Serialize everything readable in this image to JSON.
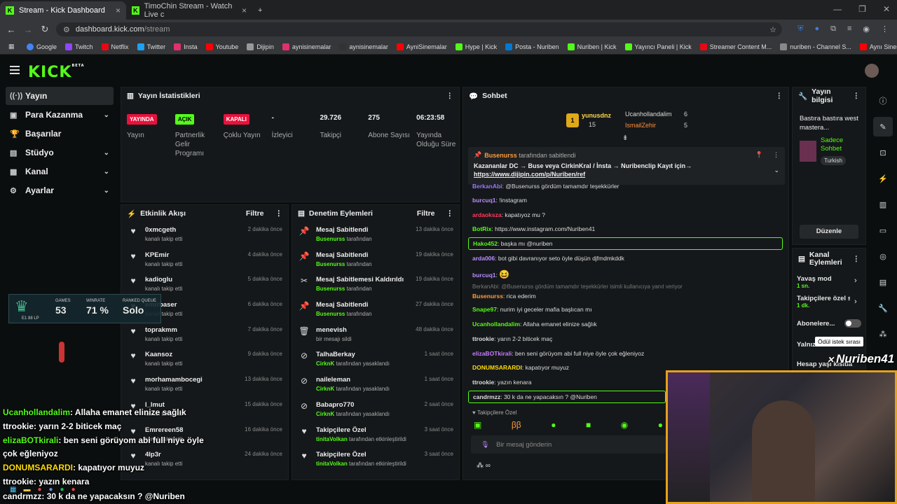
{
  "browser": {
    "tabs": [
      {
        "label": "Stream - Kick Dashboard"
      },
      {
        "label": "TimoChin Stream - Watch Live c"
      }
    ],
    "url_host": "dashboard.kick.com",
    "url_path": "/stream",
    "bookmarks": [
      "Google",
      "Twitch",
      "Netflix",
      "Twitter",
      "Insta",
      "Youtube",
      "Dijipin",
      "aynisinemalar",
      "aynisinemalar",
      "AyniSinemalar",
      "Hype | Kick",
      "Posta - Nuriben",
      "Nuriben | Kick",
      "Yayıncı Paneli | Kick",
      "Streamer Content M...",
      "nuriben - Channel S...",
      "Aynı Sinemalar - Ça..."
    ]
  },
  "header": {
    "logo": "KICK",
    "logo_sup": "BETA"
  },
  "sidebar": {
    "items": [
      {
        "label": "Yayın"
      },
      {
        "label": "Para Kazanma"
      },
      {
        "label": "Başarılar"
      },
      {
        "label": "Stüdyo"
      },
      {
        "label": "Kanal"
      },
      {
        "label": "Ayarlar"
      }
    ]
  },
  "stats": {
    "title": "Yayın İstatistikleri",
    "items": [
      {
        "value": "YAYINDA",
        "label": "Yayın"
      },
      {
        "value": "AÇIK",
        "label": "Partnerlik Gelir Programı"
      },
      {
        "value": "KAPALI",
        "label": "Çoklu Yayın"
      },
      {
        "value": "-",
        "label": "İzleyici"
      },
      {
        "value": "29.726",
        "label": "Takipçi"
      },
      {
        "value": "275",
        "label": "Abone Sayısı"
      },
      {
        "value": "06:23:58",
        "label": "Yayında Olduğu Süre"
      }
    ]
  },
  "activity": {
    "title": "Etkinlik Akışı",
    "filter": "Filtre",
    "events": [
      {
        "name": "0xmcgeth",
        "sub": "kanalı takip etti",
        "time": "2 dakika önce"
      },
      {
        "name": "KPEmir",
        "sub": "kanalı takip etti",
        "time": "4 dakika önce"
      },
      {
        "name": "kadioglu",
        "sub": "kanalı takip etti",
        "time": "5 dakika önce"
      },
      {
        "name": "emirbaser",
        "sub": "kanalı takip etti",
        "time": "6 dakika önce"
      },
      {
        "name": "toprakmm",
        "sub": "kanalı takip etti",
        "time": "7 dakika önce"
      },
      {
        "name": "Kaansoz",
        "sub": "kanalı takip etti",
        "time": "9 dakika önce"
      },
      {
        "name": "morhamambocegi",
        "sub": "kanalı takip etti",
        "time": "13 dakika önce"
      },
      {
        "name": "l_lmut",
        "sub": "kanalı takip etti",
        "time": "15 dakika önce"
      },
      {
        "name": "Emrereen58",
        "sub": "kanalı takip etti",
        "time": "16 dakika önce"
      },
      {
        "name": "4lp3r",
        "sub": "kanalı takip etti",
        "time": "24 dakika önce"
      }
    ]
  },
  "moderation": {
    "title": "Denetim Eylemleri",
    "filter": "Filtre",
    "events": [
      {
        "name": "Mesaj Sabitlendi",
        "actor": "Busenurss",
        "sub": "tarafından",
        "time": "13 dakika önce"
      },
      {
        "name": "Mesaj Sabitlendi",
        "actor": "Busenurss",
        "sub": "tarafından",
        "time": "19 dakika önce"
      },
      {
        "name": "Mesaj Sabitlemesi Kaldırıldı",
        "actor": "Busenurss",
        "sub": "tarafından",
        "time": "19 dakika önce"
      },
      {
        "name": "Mesaj Sabitlendi",
        "actor": "Busenurss",
        "sub": "tarafından",
        "time": "27 dakika önce"
      },
      {
        "name": "menevish",
        "actor": "",
        "sub": "bir mesajı sildi",
        "time": "48 dakika önce"
      },
      {
        "name": "TalhaBerkay",
        "actor": "CirknK",
        "sub": "tarafından yasaklandı",
        "time": "1 saat önce"
      },
      {
        "name": "naileleman",
        "actor": "CirknK",
        "sub": "tarafından yasaklandı",
        "time": "1 saat önce"
      },
      {
        "name": "Babapro770",
        "actor": "CirknK",
        "sub": "tarafından yasaklandı",
        "time": "2 saat önce"
      },
      {
        "name": "Takipçilere Özel",
        "actor": "tinitaVolkan",
        "sub": "tarafından etkinleştirildi",
        "time": "3 saat önce"
      },
      {
        "name": "Takipçilere Özel",
        "actor": "tinitaVolkan",
        "sub": "tarafından etkinleştirildi",
        "time": "3 saat önce"
      }
    ]
  },
  "chat": {
    "title": "Sohbet",
    "leaders": [
      {
        "name": "yunusdnz",
        "count": "15"
      },
      {
        "name": "Ucanhollandalim",
        "count": "6"
      },
      {
        "name": "IsmailZehir",
        "count": "5"
      }
    ],
    "pinned": {
      "by": "Busenurss",
      "by_suffix": "tarafından sabitlendi",
      "text": "Kazananlar DC → Buse veya CirkinKral / İnsta → Nuribenclip Kayıt için→",
      "link": "https://www.dijipin.com/p/Nuriben/ref"
    },
    "messages": [
      {
        "user": "BerkanAbi",
        "text": "@Busenurss gördüm tamamdır teşekkürler",
        "color": "#9b7bff"
      },
      {
        "user": "burcuq1",
        "text": "!instagram",
        "color": "#b98cff"
      },
      {
        "user": "ardaoksza",
        "text": "kapatıyoz mu ?",
        "color": "#ff3a5c"
      },
      {
        "user": "BotRix",
        "text": "https://www.instagram.com/Nuriben41",
        "color": "#53fc18"
      },
      {
        "user": "Hako452",
        "text": "başka mı @nuriben",
        "color": "#53fc18"
      },
      {
        "user": "arda006",
        "text": "bot gibi davranıyor seto öyle düşün djfmdmkddk",
        "color": "#b98cff"
      },
      {
        "user": "burcuq1",
        "text": "",
        "color": "#b98cff"
      },
      {
        "user": "",
        "text": "BerkanAbi: @Busenurss gördüm tamamdır teşekkürler isimli kullanıcıya yanıt veriyor",
        "color": "#777"
      },
      {
        "user": "Busenurss",
        "text": "rica ederim",
        "color": "#ff9b3a"
      },
      {
        "user": "Snape97",
        "text": "nurim iyi geceler mafia başlıcan mı",
        "color": "#53fc18"
      },
      {
        "user": "Ucanhollandalim",
        "text": "Allaha emanet elinize sağlık",
        "color": "#53fc18"
      },
      {
        "user": "ttrookie",
        "text": "yarın 2-2 biticek maç",
        "color": "#ddd"
      },
      {
        "user": "elizaBOTkirali",
        "text": "ben seni görüyom abi full niye öyle çok eğleniyoz",
        "color": "#c87bff"
      },
      {
        "user": "DONUMSARARDI",
        "text": "kapatıyor muyuz",
        "color": "#ffdd00"
      },
      {
        "user": "ttrookie",
        "text": "yazın kenara",
        "color": "#ddd"
      },
      {
        "user": "candrmzz",
        "text": "30 k da ne yapacaksın ? @Nuriben",
        "color": "#ddd"
      }
    ],
    "followers_only": "Takipçilere Özel",
    "input_placeholder": "Bir mesaj gönderin"
  },
  "stream_info": {
    "title": "Yayın bilgisi",
    "stream_title": "Bastıra bastıra west mastera...",
    "category": "Sadece Sohbet",
    "tag": "Turkish",
    "edit": "Düzenle"
  },
  "channel_actions": {
    "title": "Kanal Eylemleri",
    "items": [
      {
        "label": "Yavaş mod",
        "sub": "1 sn."
      },
      {
        "label": "Takipçilere özel s",
        "sub": "1 dk."
      },
      {
        "label": "Abonelere...",
        "sub": ""
      },
      {
        "label": "Yalnız",
        "sub": ""
      },
      {
        "label": "Hesap yaşı kısıtla",
        "sub": ""
      }
    ],
    "tooltip": "Ödül istek sırası"
  },
  "overlay": {
    "rank": {
      "games_label": "GAMES",
      "games": "53",
      "winrate_label": "WINRATE",
      "winrate": "71 %",
      "ranked_label": "RANKED QUEUE",
      "ranked": "Solo",
      "lp": "E1 88 LP"
    },
    "chat": [
      {
        "user": "Ucanhollandalim",
        "text": ": Allaha emanet elinize sağlık",
        "color": "#53fc18"
      },
      {
        "user": "ttrookie",
        "text": ": yarın 2-2 biticek maç",
        "color": "#ffffff"
      },
      {
        "user": "elizaBOTkirali",
        "text": ": ben seni görüyom abi full niye öyle",
        "color": "#53fc18"
      },
      {
        "user": "",
        "text": "çok eğleniyoz",
        "color": "#ffffff"
      },
      {
        "user": "DONUMSARARDI",
        "text": ": kapatıyor muyuz",
        "color": "#ffdd00"
      },
      {
        "user": "ttrookie",
        "text": ": yazın kenara",
        "color": "#ffffff"
      },
      {
        "user": "candrmzz",
        "text": ": 30 k da ne yapacaksın ? @Nuriben",
        "color": "#ffffff"
      }
    ],
    "watermark": "Nuriben41"
  },
  "colors": {
    "accent": "#53fc18",
    "live": "#e9113c",
    "webcam_border": "#e6a11a"
  }
}
